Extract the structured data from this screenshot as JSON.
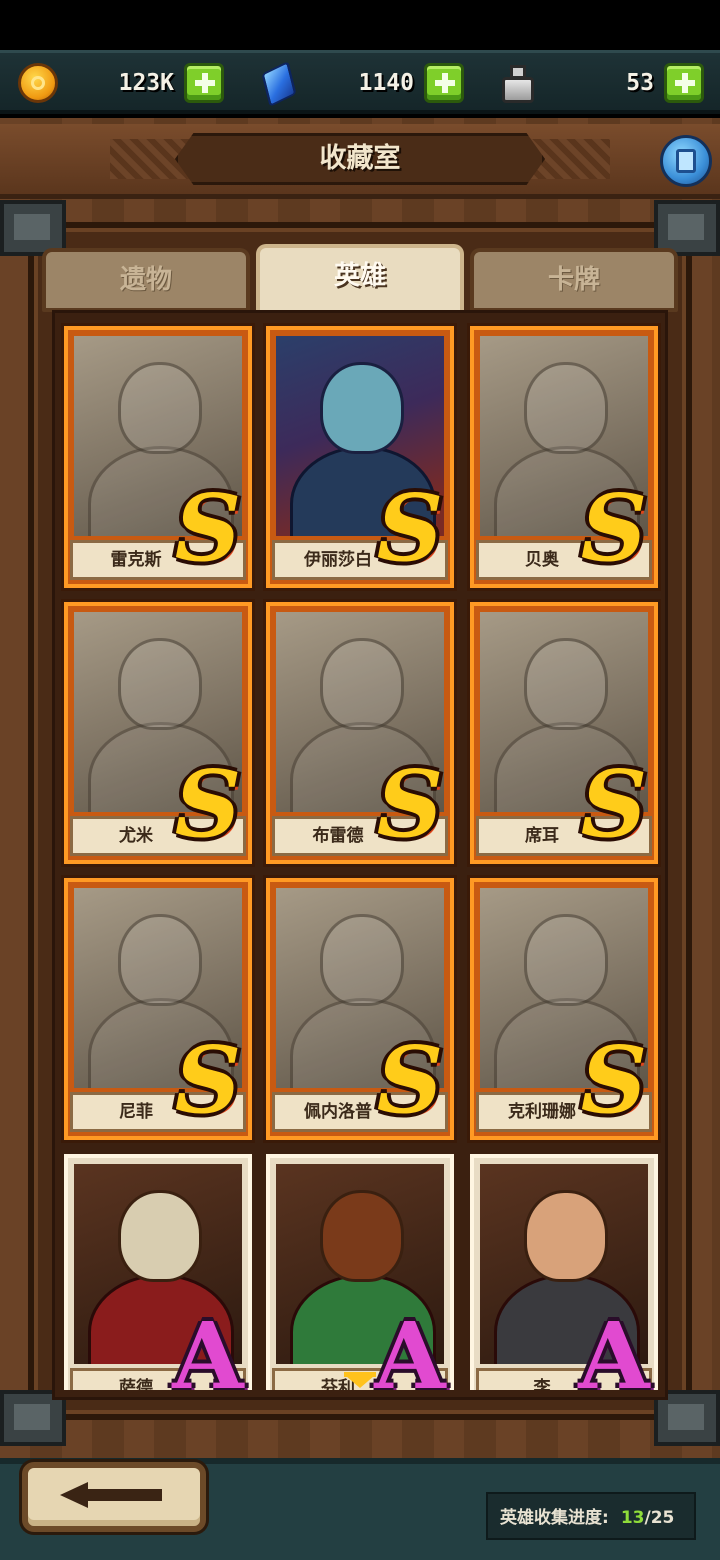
{
  "resources": {
    "gold": {
      "icon": "gold-coin-icon",
      "value": "123K"
    },
    "gems": {
      "icon": "blue-gem-icon",
      "value": "1140"
    },
    "potions": {
      "icon": "potion-bottle-icon",
      "value": "53"
    }
  },
  "header": {
    "title": "收藏室"
  },
  "tabs": [
    {
      "label": "遗物",
      "active": false
    },
    {
      "label": "英雄",
      "active": true
    },
    {
      "label": "卡牌",
      "active": false
    }
  ],
  "heroes": [
    {
      "name": "雷克斯",
      "rank": "S",
      "unlocked": false
    },
    {
      "name": "伊丽莎白",
      "rank": "S",
      "unlocked": true
    },
    {
      "name": "贝奥",
      "rank": "S",
      "unlocked": false
    },
    {
      "name": "尤米",
      "rank": "S",
      "unlocked": false
    },
    {
      "name": "布雷德",
      "rank": "S",
      "unlocked": false
    },
    {
      "name": "席耳",
      "rank": "S",
      "unlocked": false
    },
    {
      "name": "尼菲",
      "rank": "S",
      "unlocked": false
    },
    {
      "name": "佩内洛普",
      "rank": "S",
      "unlocked": false
    },
    {
      "name": "克利珊娜",
      "rank": "S",
      "unlocked": false
    },
    {
      "name": "萨德",
      "rank": "A",
      "unlocked": true
    },
    {
      "name": "芬利",
      "rank": "A",
      "unlocked": true
    },
    {
      "name": "李",
      "rank": "A",
      "unlocked": true
    }
  ],
  "footer": {
    "progress_label": "英雄收集进度:",
    "collected": "13",
    "total": "/25"
  },
  "colors": {
    "rank_s": "#ffcc1a",
    "rank_a": "#e14ad0",
    "plus_button": "#7fcf2a",
    "progress_count": "#8fdc3a"
  }
}
